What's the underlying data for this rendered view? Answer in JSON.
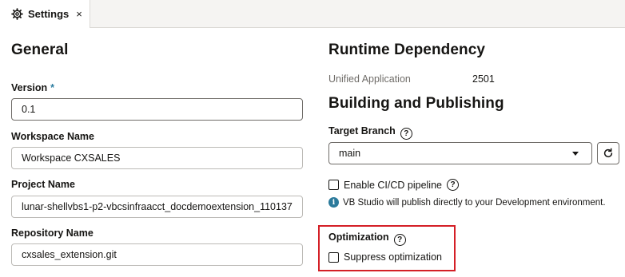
{
  "tab": {
    "icon": "gear-icon",
    "label": "Settings",
    "close": "×"
  },
  "general": {
    "heading": "General",
    "version_label": "Version",
    "required_mark": "*",
    "version_value": "0.1",
    "workspace_label": "Workspace Name",
    "workspace_value": "Workspace CXSALES",
    "project_label": "Project Name",
    "project_value": "lunar-shellvbs1-p2-vbcsinfraacct_docdemoextension_110137",
    "repo_label": "Repository Name",
    "repo_value": "cxsales_extension.git"
  },
  "runtime": {
    "heading": "Runtime Dependency",
    "app_label": "Unified Application",
    "app_value": "2501"
  },
  "building": {
    "heading": "Building and Publishing",
    "branch_label": "Target Branch",
    "help_glyph": "?",
    "branch_value": "main",
    "cicd_label": "Enable CI/CD pipeline",
    "cicd_checked": false,
    "info_text": "VB Studio will publish directly to your Development environment.",
    "info_glyph": "i"
  },
  "optimization": {
    "heading": "Optimization",
    "suppress_label": "Suppress optimization",
    "suppress_checked": false,
    "highlight_color": "#d41f26"
  }
}
